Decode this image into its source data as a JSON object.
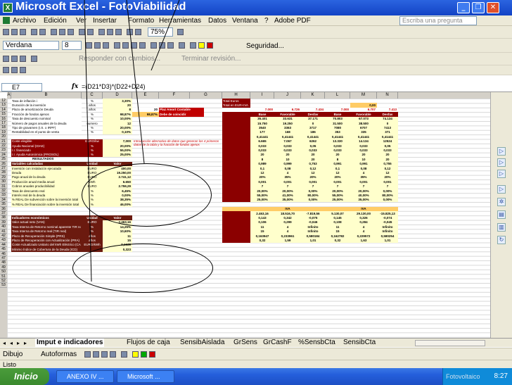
{
  "window": {
    "title": "Microsoft Excel - FotoViabilidad",
    "app_icon": "excel-icon"
  },
  "menu": {
    "items": [
      "Archivo",
      "Edición",
      "Ver",
      "Insertar",
      "Formato",
      "Herramientas",
      "Datos",
      "Ventana",
      "?",
      "Adobe PDF"
    ],
    "ask_placeholder": "Escriba una pregunta"
  },
  "toolbar": {
    "zoom": "75%",
    "font": "Verdana",
    "size": "8",
    "security": "Seguridad...",
    "reply_text": "Responder con cambios...",
    "end_review": "Terminar revisión..."
  },
  "formula_bar": {
    "cell": "E7",
    "formula": "=(D21*D3)*(D22+D24)"
  },
  "columns": [
    "A",
    "B",
    "C",
    "D",
    "E",
    "F",
    "G",
    "H",
    "I",
    "J",
    "K",
    "L",
    "M",
    "N"
  ],
  "rows": [
    "12",
    "13",
    "14",
    "15",
    "16",
    "17",
    "18",
    "19",
    "20",
    "21",
    "22",
    "23",
    "24",
    "25",
    "26",
    "27",
    "28",
    "29",
    "30",
    "31",
    "32",
    "33",
    "34",
    "35",
    "36",
    "37",
    "38",
    "39",
    "40",
    "41",
    "42",
    "43",
    "44",
    "45",
    "46",
    "47",
    "48",
    "49",
    "50",
    "51",
    "52",
    "53"
  ],
  "sheet": {
    "params": [
      {
        "label": "Tasa de inflación i",
        "unit": "%",
        "value": "3,30%"
      },
      {
        "label": "Duración de la inversión",
        "unit": "años",
        "value": "20"
      },
      {
        "label": "Plazo de amortización Deuda",
        "unit": "años",
        "value": "8"
      },
      {
        "label": "Fracción de fondos ajenos",
        "unit": "%",
        "value": "98,87%"
      },
      {
        "label": "Tasa de descuento nominal",
        "unit": "%",
        "value": "10,00%"
      },
      {
        "label": "Número de pagos anuales de la deuda",
        "unit": "numero",
        "value": "12"
      },
      {
        "label": "Tipo de gravamen (I.S. o IRPF)",
        "unit": "%",
        "value": "20,00%"
      },
      {
        "label": "Rentabilidad en el punto de venta",
        "unit": "%",
        "value": "0,10%"
      }
    ],
    "dark_rows": [
      {
        "label": "Coste elegible",
        "unit": "EURO/kw",
        "value": "7,000"
      },
      {
        "label": "Ayuda Nacional (IDAE)",
        "unit": "%",
        "value": "20,00%"
      },
      {
        "label": "I.I. financiado",
        "unit": "%",
        "value": "55,00%"
      },
      {
        "label": "I.I. Ayuda Autonómica (PROSOL)",
        "unit": "%",
        "value": "25,00%"
      }
    ],
    "e_values": [
      "98,87%",
      "20",
      "Plaz Amort Contable",
      "Debe de coincidir"
    ],
    "note": "Introducción alternativa de datos que generan los 4 primeros datos de la tabla y la fracción de fondos ajenos",
    "resultados_title": "RESULTADOS",
    "vars_header": [
      "Variables calculadas",
      "Unidad",
      "Valor"
    ],
    "vars": [
      {
        "label": "Inversión con instalación ejecutada",
        "unit": "EURO",
        "value": "400,00"
      },
      {
        "label": "Deuda",
        "unit": "EURO",
        "value": "19.250,00"
      },
      {
        "label": "Pago anual de la deuda",
        "unit": "EURO",
        "value": "2.741,12"
      },
      {
        "label": "Producción anual media anual",
        "unit": "kWh",
        "value": "6.650"
      },
      {
        "label": "Cobros anuales producibilidad",
        "unit": "EURO",
        "value": "2.759,29"
      },
      {
        "label": "Tasa de descuento real",
        "unit": "%",
        "value": "6,45%"
      },
      {
        "label": "Interés real de la deuda",
        "unit": "%",
        "value": "0,00%"
      },
      {
        "label": "% REAL De subvención sobre la inversión total",
        "unit": "%",
        "value": "38,35%"
      },
      {
        "label": "% REAL De financiación sobre la inversión total",
        "unit": "%",
        "value": "46,00%"
      }
    ],
    "ind_header": [
      "Indicadores económicos",
      "Unidad",
      "Valor"
    ],
    "ind": [
      {
        "label": "Valor actual neto (VAN)",
        "unit": "EURO",
        "value": "2.463,16"
      },
      {
        "label": "Tasa Interna de Retorno nominal aparente TIR nominal",
        "unit": "%",
        "value": "14,25%"
      },
      {
        "label": "Tasa Interna de Retorno real (TIR real)",
        "unit": "%",
        "value": "10,60%"
      },
      {
        "label": "Plazo de Recuperación Simple (PRS)",
        "unit": "años",
        "value": "11"
      },
      {
        "label": "Plazo de Recuperación con Actualización (PRA)",
        "unit": "años",
        "value": "15"
      },
      {
        "label": "Coste Actualizado Unitario del kWh Eléctrico (CAF)",
        "unit": "EURO/kWh",
        "value": "0,1639"
      },
      {
        "label": "Mínimo Índice de Cobertura de la Deuda (ICD)",
        "unit": "",
        "value": "0,323"
      }
    ],
    "right_title": [
      "Total Euros",
      "Total en EUR+IVA"
    ],
    "right_amount": "0,00",
    "right_headers": [
      "Base",
      "Favorable",
      "Desfav",
      "Base",
      "Favorable",
      "Desfav"
    ],
    "right_top": [
      "7.000",
      "6.726",
      "7.434",
      "7.000",
      "6.707",
      "7.413"
    ],
    "right_grid": [
      [
        "35.401",
        "33.631",
        "37.171",
        "70.803",
        "67.073",
        "74.134"
      ],
      [
        "15.750",
        "19.250",
        "0",
        "31.500",
        "38.500",
        "0"
      ],
      [
        "3540",
        "3363",
        "3717",
        "7080",
        "6707",
        "7413"
      ],
      [
        "177",
        "168",
        "186",
        "353",
        "335",
        "371"
      ],
      [
        "0,41441",
        "0,41441",
        "0,41441",
        "0,41441",
        "0,41441",
        "0,41441"
      ],
      [
        "6.665",
        "7.067",
        "6262",
        "13.330",
        "14.134",
        "12524"
      ],
      [
        "0,033",
        "0,033",
        "0,05",
        "0,033",
        "0,033",
        "0,05"
      ],
      [
        "0,033",
        "0,033",
        "0,033",
        "0,033",
        "0,033",
        "0,033"
      ],
      [
        "20",
        "20",
        "20",
        "20",
        "20",
        "20"
      ],
      [
        "8",
        "10",
        "20",
        "8",
        "10",
        "20"
      ],
      [
        "0,989",
        "0,999",
        "0,753",
        "0,991",
        "0,991",
        "0,755"
      ],
      [
        "0,1",
        "0,08",
        "0,12",
        "0,1",
        "0,08",
        "0,12"
      ],
      [
        "12",
        "4",
        "12",
        "12",
        "4",
        "12"
      ],
      [
        "20%",
        "35%",
        "20%",
        "20%",
        "35%",
        "20%"
      ],
      [
        "0,001",
        "0,001",
        "0,001",
        "0,001",
        "0,001",
        "0,001"
      ],
      [
        "7",
        "7",
        "7",
        "7",
        "7",
        "7"
      ],
      [
        "20,00%",
        "20,00%",
        "0,00%",
        "20,00%",
        "20,00%",
        "0,00%"
      ],
      [
        "55,00%",
        "41,00%",
        "80,00%",
        "55,00%",
        "40,00%",
        "80,00%"
      ],
      [
        "25,00%",
        "35,00%",
        "0,00%",
        "25,00%",
        "35,00%",
        "0,00%"
      ]
    ],
    "right_iva": [
      "IVA",
      "IVA"
    ],
    "right_ind": [
      [
        "2.463,16",
        "18.516,70",
        "-7.819,56",
        "5.130,07",
        "29.130,00",
        "-15.825,13"
      ],
      [
        "0,143",
        "0,342",
        "-0,075",
        "0,145",
        "0,326",
        "-0,074"
      ],
      [
        "0,106",
        "0,299",
        "-0,046",
        "0,108",
        "0,284",
        "-0,045"
      ],
      [
        "11",
        "4",
        "Infinito",
        "11",
        "4",
        "Infinito"
      ],
      [
        "15",
        "4",
        "Infinito",
        "15",
        "4",
        "Infinito"
      ],
      [
        "0,163947",
        "0,233961",
        "0,580184",
        "0,162782",
        "0,229572",
        "0,580254"
      ],
      [
        "0,32",
        "1,59",
        "1,01",
        "0,32",
        "1,63",
        "1,01"
      ]
    ]
  },
  "tabs": {
    "active": "Imput e indicadores",
    "items": [
      "Flujos de caja",
      "SensibAislada",
      "GrSens",
      "GrCashF",
      "%SensbCta",
      "SensibCta"
    ]
  },
  "drawbar": {
    "dibujo": "Dibujo",
    "autoformas": "Autoformas"
  },
  "status": {
    "text": "Listo"
  },
  "taskbar": {
    "start": "Inicio",
    "tasks": [
      "ANEXO IV ...",
      "Microsoft ..."
    ],
    "tray_label": "Fotovoltaico",
    "clock": "8:27"
  },
  "colors": {
    "dark_red": "#8b0000",
    "header_brown": "#6b1a0f",
    "cream": "#ffffcc",
    "orange": "#ffcc66",
    "bright_red": "#c00000"
  }
}
